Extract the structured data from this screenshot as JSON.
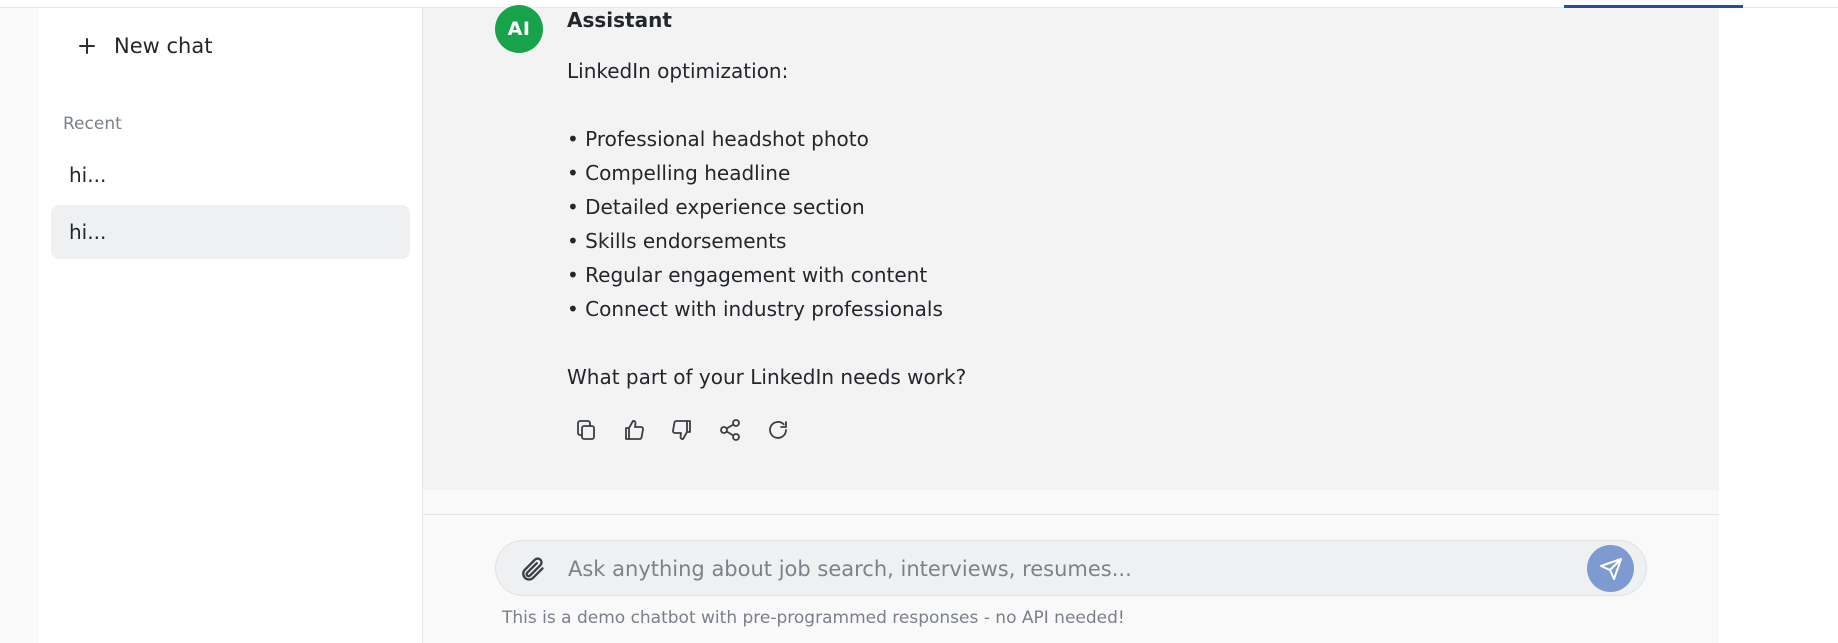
{
  "sidebar": {
    "new_chat_label": "New chat",
    "recent_label": "Recent",
    "history": [
      {
        "label": "hi..."
      },
      {
        "label": "hi..."
      }
    ]
  },
  "message": {
    "avatar_text": "AI",
    "author": "Assistant",
    "intro": "LinkedIn optimization:",
    "bullets": [
      "• Professional headshot photo",
      "• Compelling headline",
      "• Detailed experience section",
      "• Skills endorsements",
      "• Regular engagement with content",
      "• Connect with industry professionals"
    ],
    "closing": "What part of your LinkedIn needs work?"
  },
  "actions": [
    "copy-icon",
    "thumbs-up-icon",
    "thumbs-down-icon",
    "share-icon",
    "regenerate-icon"
  ],
  "composer": {
    "placeholder": "Ask anything about job search, interviews, resumes...",
    "value": "",
    "note": "This is a demo chatbot with pre-programmed responses - no API needed!"
  },
  "colors": {
    "avatar_bg": "#16a34a",
    "send_bg": "#7d9bd0",
    "accent": "#1f4fa3"
  }
}
